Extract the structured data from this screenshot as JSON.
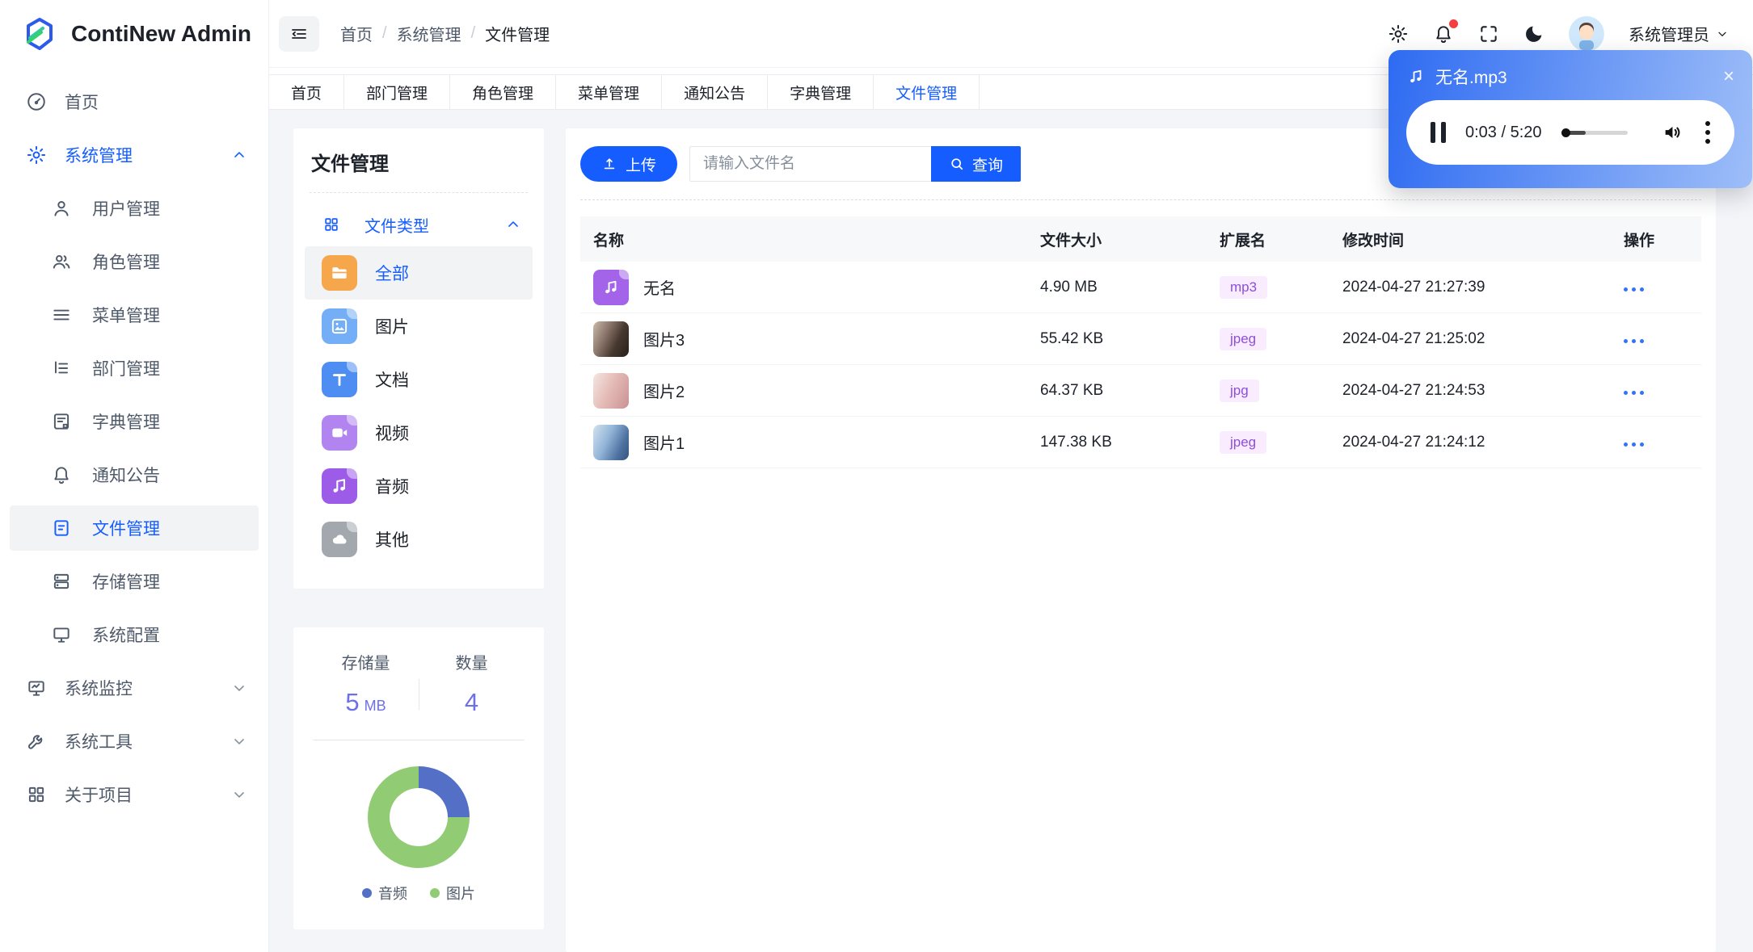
{
  "app": {
    "title": "ContiNew Admin"
  },
  "topbar": {
    "breadcrumb": [
      "首页",
      "系统管理",
      "文件管理"
    ],
    "separator": "/",
    "username": "系统管理员",
    "icons": [
      "menu-fold-icon",
      "gear-icon",
      "bell-icon",
      "fullscreen-icon",
      "moon-icon",
      "avatar",
      "chevron-down-icon"
    ]
  },
  "tabs": [
    {
      "label": "首页",
      "active": false
    },
    {
      "label": "部门管理",
      "active": false
    },
    {
      "label": "角色管理",
      "active": false
    },
    {
      "label": "菜单管理",
      "active": false
    },
    {
      "label": "通知公告",
      "active": false
    },
    {
      "label": "字典管理",
      "active": false
    },
    {
      "label": "文件管理",
      "active": true
    }
  ],
  "sidebar": {
    "items": [
      {
        "label": "首页",
        "icon": "dashboard-icon",
        "level": 1
      },
      {
        "label": "系统管理",
        "icon": "gear-icon",
        "level": 1,
        "expanded": true
      },
      {
        "label": "用户管理",
        "icon": "user-icon",
        "level": 2
      },
      {
        "label": "角色管理",
        "icon": "users-icon",
        "level": 2
      },
      {
        "label": "菜单管理",
        "icon": "menu-lines-icon",
        "level": 2
      },
      {
        "label": "部门管理",
        "icon": "tree-icon",
        "level": 2
      },
      {
        "label": "字典管理",
        "icon": "dictionary-icon",
        "level": 2
      },
      {
        "label": "通知公告",
        "icon": "bell-icon",
        "level": 2
      },
      {
        "label": "文件管理",
        "icon": "file-icon",
        "level": 2,
        "selected": true
      },
      {
        "label": "存储管理",
        "icon": "storage-icon",
        "level": 2
      },
      {
        "label": "系统配置",
        "icon": "monitor-icon",
        "level": 2
      },
      {
        "label": "系统监控",
        "icon": "monitor-chart-icon",
        "level": 1,
        "collapsed": true
      },
      {
        "label": "系统工具",
        "icon": "wrench-icon",
        "level": 1,
        "collapsed": true
      },
      {
        "label": "关于项目",
        "icon": "grid-icon",
        "level": 1,
        "collapsed": true
      }
    ]
  },
  "file_panel": {
    "title": "文件管理",
    "group": {
      "icon": "grid-icon",
      "label": "文件类型"
    },
    "types": [
      {
        "label": "全部",
        "icon": "folder-icon",
        "color": "#f7a74b",
        "active": true
      },
      {
        "label": "图片",
        "icon": "image-icon",
        "color": "#74aef6",
        "active": false
      },
      {
        "label": "文档",
        "icon": "text-file-icon",
        "color": "#4e8df2",
        "active": false
      },
      {
        "label": "视频",
        "icon": "video-icon",
        "color": "#b184ef",
        "active": false
      },
      {
        "label": "音频",
        "icon": "music-icon",
        "color": "#9c5ce8",
        "active": false
      },
      {
        "label": "其他",
        "icon": "cloud-icon",
        "color": "#a3a8ae",
        "active": false
      }
    ]
  },
  "storage_panel": {
    "stats": [
      {
        "label": "存储量",
        "value": "5",
        "unit": "MB"
      },
      {
        "label": "数量",
        "value": "4",
        "unit": ""
      }
    ],
    "legend": [
      {
        "label": "音频",
        "color": "#5470c6"
      },
      {
        "label": "图片",
        "color": "#91cc75"
      }
    ]
  },
  "chart_data": {
    "type": "pie",
    "donut": true,
    "categories": [
      "音频",
      "图片"
    ],
    "values": [
      1,
      3
    ],
    "percentages": [
      25,
      75
    ],
    "colors": [
      "#5470c6",
      "#91cc75"
    ],
    "legend_position": "bottom",
    "title": ""
  },
  "toolbar": {
    "upload_label": "上传",
    "search_placeholder": "请输入文件名",
    "search_value": "",
    "query_label": "查询"
  },
  "table": {
    "headers": [
      "名称",
      "文件大小",
      "扩展名",
      "修改时间",
      "操作"
    ],
    "rows": [
      {
        "name": "无名",
        "size": "4.90 MB",
        "ext": "mp3",
        "time": "2024-04-27 21:27:39",
        "thumb": "audio-file"
      },
      {
        "name": "图片3",
        "size": "55.42 KB",
        "ext": "jpeg",
        "time": "2024-04-27 21:25:02",
        "thumb": "photo"
      },
      {
        "name": "图片2",
        "size": "64.37 KB",
        "ext": "jpg",
        "time": "2024-04-27 21:24:53",
        "thumb": "photo"
      },
      {
        "name": "图片1",
        "size": "147.38 KB",
        "ext": "jpeg",
        "time": "2024-04-27 21:24:12",
        "thumb": "photo"
      }
    ]
  },
  "player": {
    "title": "无名.mp3",
    "time": "0:03 / 5:20",
    "close_label": "×"
  },
  "colors": {
    "primary": "#165dff",
    "badge_bg": "#f9ecff",
    "badge_text": "#8d4eda",
    "notification_dot": "#f53f3f",
    "player_gradient_start": "#2e6bf2",
    "player_gradient_end": "#9ebef8",
    "donut_gradient": "conic-gradient(#5470c6 0 25%, #91cc75 25% 100%)"
  }
}
